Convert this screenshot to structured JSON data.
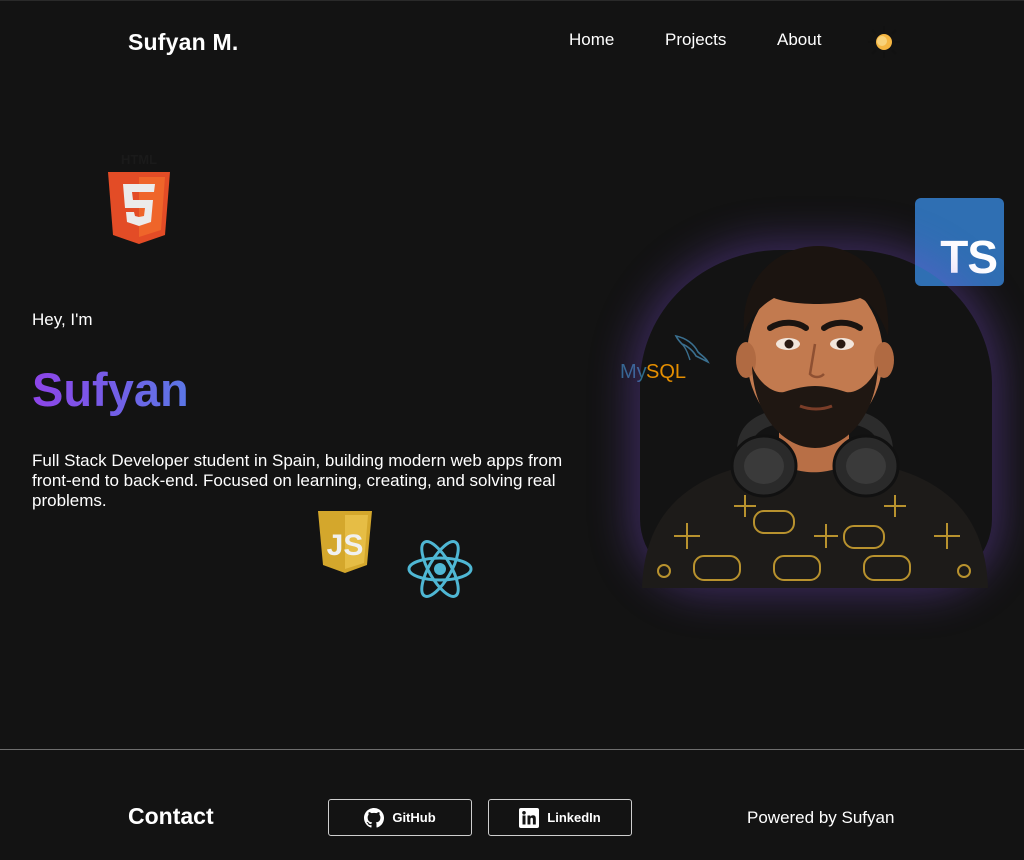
{
  "header": {
    "brand": "Sufyan M.",
    "nav": [
      {
        "label": "Home"
      },
      {
        "label": "Projects"
      },
      {
        "label": "About"
      }
    ],
    "theme_toggle_icon": "sun-icon"
  },
  "hero": {
    "greeting": "Hey, I'm",
    "name": "Sufyan",
    "description": "Full Stack Developer student in Spain, building modern web apps from front-end to back-end. Focused on learning, creating, and solving real problems.",
    "gradient": [
      "#8e44e8",
      "#5b77e6"
    ]
  },
  "tech_icons": {
    "html": {
      "label": "HTML",
      "icon": "html5-icon",
      "color": "#e34c26"
    },
    "typescript": {
      "label": "TS",
      "icon": "typescript-icon",
      "color": "#2f6fb3"
    },
    "mysql": {
      "label": "MySQL",
      "icon": "mysql-icon",
      "color": "#00758f"
    },
    "javascript": {
      "label": "JS",
      "icon": "javascript-icon",
      "color": "#d4a72c"
    },
    "react": {
      "icon": "react-icon",
      "color": "#4fb7d4"
    }
  },
  "portrait": {
    "icon": "avatar-illustration"
  },
  "footer": {
    "contact_title": "Contact",
    "github_label": "GitHub",
    "linkedin_label": "LinkedIn",
    "powered_by": "Powered by Sufyan"
  },
  "colors": {
    "background": "#131313",
    "text": "#ffffff",
    "footer_divider": "#6e6e6e"
  }
}
